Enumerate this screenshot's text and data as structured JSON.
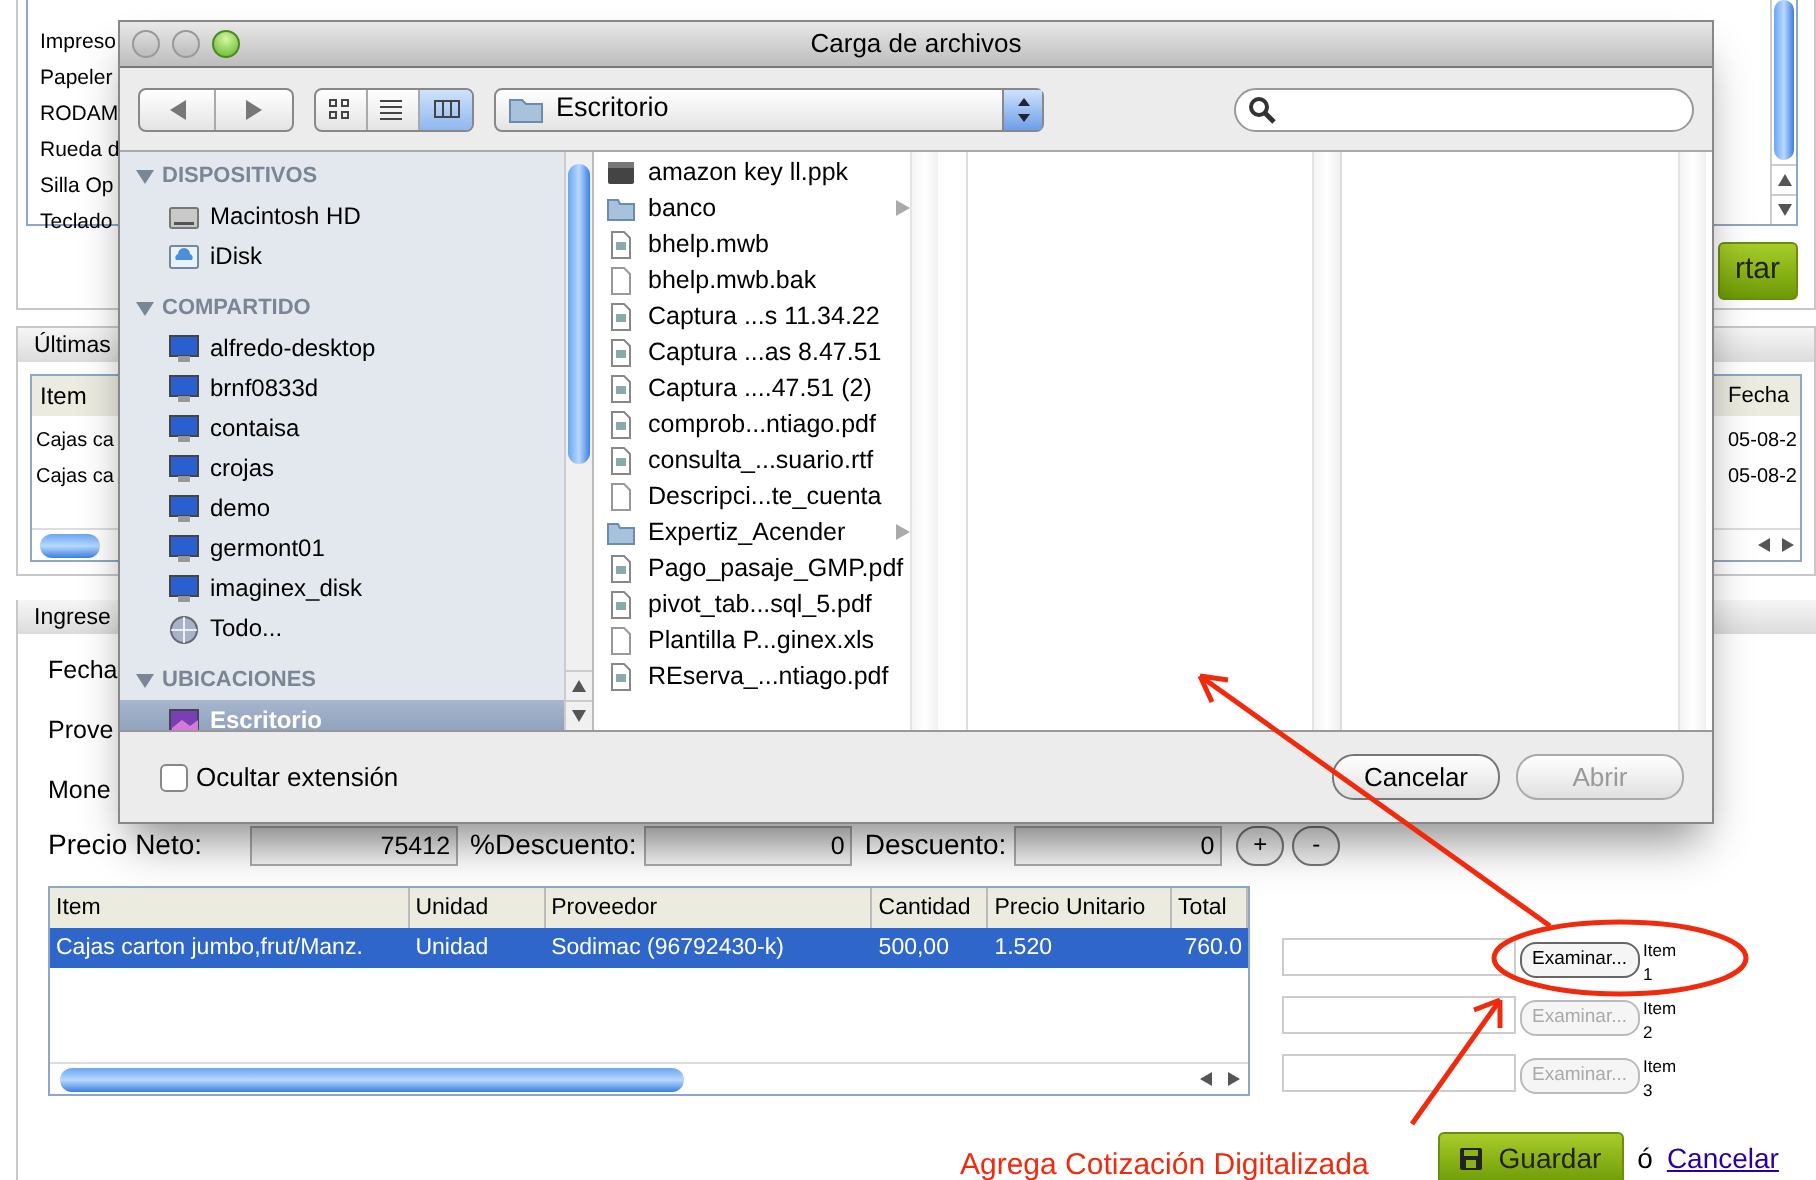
{
  "background": {
    "top_list": {
      "rows": [
        "Impreso",
        "Papeler",
        "RODAM",
        "Rueda d",
        "Silla Op",
        "Teclado"
      ]
    },
    "top_button": {
      "label": "rtar"
    },
    "recent": {
      "tab": "Últimas",
      "columns": [
        "Item",
        "Fecha"
      ],
      "rows": [
        {
          "item": "Cajas ca",
          "fecha": "05-08-2"
        },
        {
          "item": "Cajas ca",
          "fecha": "05-08-2"
        }
      ]
    },
    "entry": {
      "tab": "Ingrese",
      "labels": [
        "Fecha",
        "Prove",
        "Mone"
      ]
    }
  },
  "dialog": {
    "title": "Carga de archivos",
    "location": "Escritorio",
    "view_modes": [
      {
        "kind": "icons",
        "selected": false
      },
      {
        "kind": "list",
        "selected": false
      },
      {
        "kind": "columns",
        "selected": true
      }
    ],
    "sidebar": [
      {
        "heading": "DISPOSITIVOS",
        "expanded": true,
        "items": [
          {
            "label": "Macintosh HD",
            "kind": "disk",
            "selected": false
          },
          {
            "label": "iDisk",
            "kind": "idisk",
            "selected": false
          }
        ]
      },
      {
        "heading": "COMPARTIDO",
        "expanded": true,
        "items": [
          {
            "label": "alfredo-desktop",
            "kind": "computer",
            "selected": false
          },
          {
            "label": "brnf0833d",
            "kind": "computer",
            "selected": false
          },
          {
            "label": "contaisa",
            "kind": "computer",
            "selected": false
          },
          {
            "label": "crojas",
            "kind": "computer",
            "selected": false
          },
          {
            "label": "demo",
            "kind": "computer",
            "selected": false
          },
          {
            "label": "germont01",
            "kind": "computer",
            "selected": false
          },
          {
            "label": "imaginex_disk",
            "kind": "computer",
            "selected": false
          },
          {
            "label": "Todo...",
            "kind": "globe",
            "selected": false
          }
        ]
      },
      {
        "heading": "UBICACIONES",
        "expanded": true,
        "items": [
          {
            "label": "Escritorio",
            "kind": "desktop",
            "selected": true
          }
        ]
      }
    ],
    "files": [
      {
        "name": "amazon key ll.ppk",
        "kind": "app",
        "has_children": false
      },
      {
        "name": "banco",
        "kind": "folder",
        "has_children": true
      },
      {
        "name": "bhelp.mwb",
        "kind": "document",
        "has_children": false
      },
      {
        "name": "bhelp.mwb.bak",
        "kind": "blank",
        "has_children": false
      },
      {
        "name": "Captura ...s 11.34.22",
        "kind": "document",
        "has_children": false
      },
      {
        "name": "Captura ...as 8.47.51",
        "kind": "document",
        "has_children": false
      },
      {
        "name": "Captura ....47.51 (2)",
        "kind": "document",
        "has_children": false
      },
      {
        "name": "comprob...ntiago.pdf",
        "kind": "document",
        "has_children": false
      },
      {
        "name": "consulta_...suario.rtf",
        "kind": "document",
        "has_children": false
      },
      {
        "name": "Descripci...te_cuenta",
        "kind": "blank",
        "has_children": false
      },
      {
        "name": "Expertiz_Acender",
        "kind": "folder",
        "has_children": true
      },
      {
        "name": "Pago_pasaje_GMP.pdf",
        "kind": "document",
        "has_children": false
      },
      {
        "name": "pivot_tab...sql_5.pdf",
        "kind": "document",
        "has_children": false
      },
      {
        "name": "Plantilla P...ginex.xls",
        "kind": "blank",
        "has_children": false
      },
      {
        "name": "REserva_...ntiago.pdf",
        "kind": "document",
        "has_children": false
      }
    ],
    "hide_extension": {
      "label": "Ocultar extensión",
      "checked": false
    },
    "buttons": [
      {
        "label": "Cancelar",
        "disabled": false
      },
      {
        "label": "Abrir",
        "disabled": true
      }
    ]
  },
  "form": {
    "fields": [
      {
        "label": "Precio Neto:",
        "value": "75412"
      },
      {
        "label": "%Descuento:",
        "value": "0"
      },
      {
        "label": "Descuento:",
        "value": "0"
      }
    ],
    "step_buttons": [
      "+",
      "-"
    ]
  },
  "items_table": {
    "columns": [
      "Item",
      "Unidad",
      "Proveedor",
      "Cantidad",
      "Precio Unitario",
      "Total"
    ],
    "rows": [
      {
        "cells": [
          "Cajas carton jumbo,frut/Manz.",
          "Unidad",
          "Sodimac (96792430-k)",
          "500,00",
          "1.520",
          "760.0"
        ],
        "selected": true
      }
    ]
  },
  "uploads": [
    {
      "button": "Examinar...",
      "label": "Item 1",
      "disabled": false
    },
    {
      "button": "Examinar...",
      "label": "Item 2",
      "disabled": true
    },
    {
      "button": "Examinar...",
      "label": "Item 3",
      "disabled": true
    }
  ],
  "annotation": {
    "text": "Agrega Cotización Digitalizada"
  },
  "actions": {
    "save": "Guardar",
    "separator": "ó",
    "cancel": "Cancelar"
  }
}
